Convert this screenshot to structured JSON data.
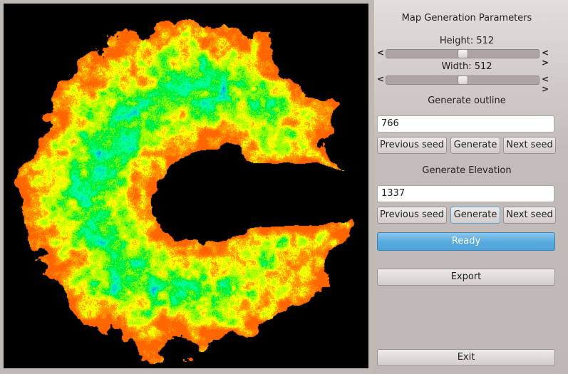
{
  "panel": {
    "title": "Map Generation Parameters",
    "height_label": "Height:  512",
    "height_value": 512,
    "width_label": "Width: 512",
    "width_value": 512,
    "slider_fraction": 0.5,
    "outline": {
      "heading": "Generate outline",
      "seed": "766",
      "prev": "Previous seed",
      "generate": "Generate",
      "next": "Next seed"
    },
    "elevation": {
      "heading": "Generate Elevation",
      "seed": "1337",
      "prev": "Previous seed",
      "generate": "Generate",
      "next": "Next seed"
    },
    "status": "Ready",
    "export": "Export",
    "exit": "Exit"
  },
  "map": {
    "palette": [
      "#ff6600",
      "#ff9900",
      "#ffff00",
      "#99ff00",
      "#00ee33",
      "#00ff99",
      "#00cccc",
      "#3366ff",
      "#6611ee"
    ],
    "background": "#000000"
  }
}
